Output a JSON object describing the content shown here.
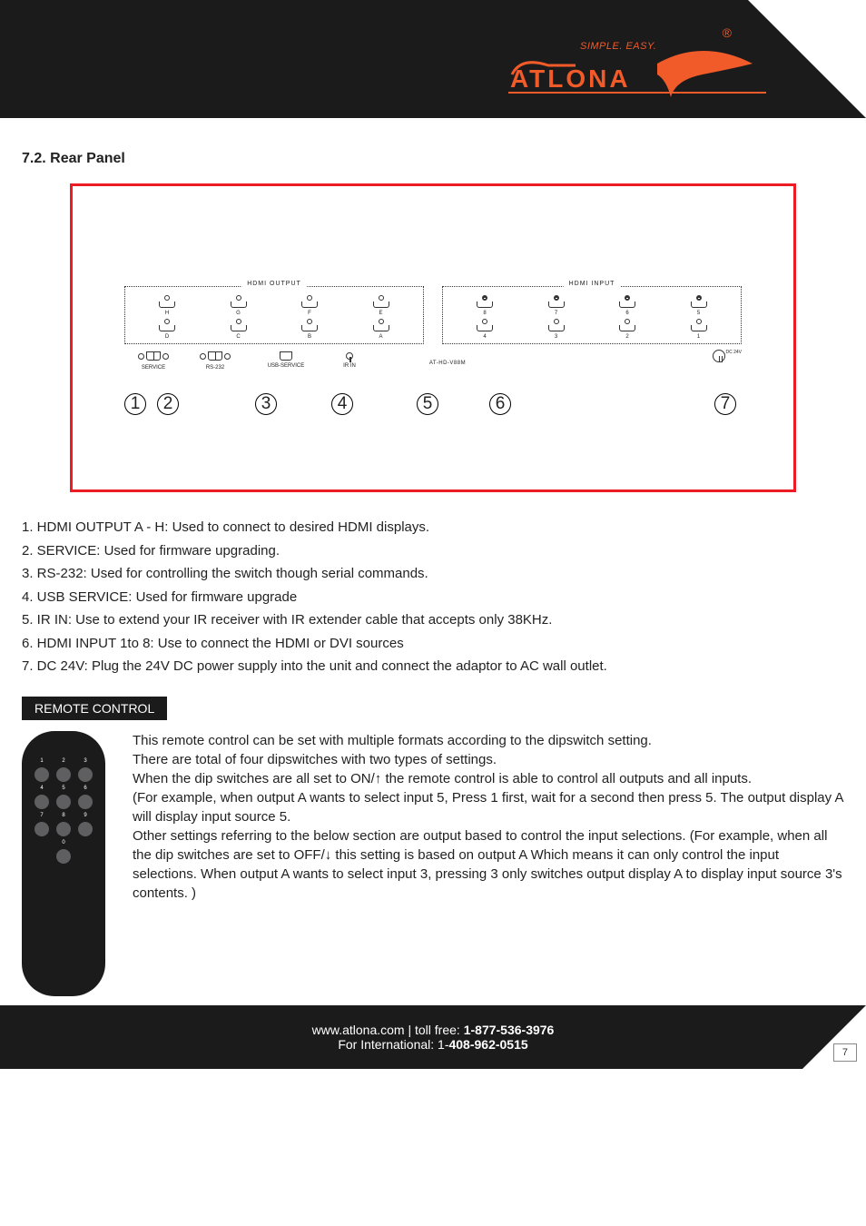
{
  "brand": {
    "tagline": "SIMPLE. EASY.",
    "name": "ATLONA",
    "reg": "®"
  },
  "section_title": "7.2. Rear Panel",
  "panel": {
    "output_label": "HDMI OUTPUT",
    "input_label": "HDMI INPUT",
    "outputs_top": [
      "H",
      "G",
      "F",
      "E"
    ],
    "outputs_bot": [
      "D",
      "C",
      "B",
      "A"
    ],
    "inputs_top": [
      "8",
      "7",
      "6",
      "5"
    ],
    "inputs_bot": [
      "4",
      "3",
      "2",
      "1"
    ],
    "under": {
      "service": "SERVICE",
      "rs232": "RS-232",
      "usb": "USB-SERVICE",
      "ir": "IR IN",
      "model": "AT-HD-V88M",
      "dc": "DC 24V"
    },
    "callouts": [
      "1",
      "2",
      "3",
      "4",
      "5",
      "6",
      "7"
    ]
  },
  "descriptions": [
    "1. HDMI OUTPUT A - H: Used to connect to desired HDMI displays.",
    "2. SERVICE: Used for firmware upgrading.",
    "3. RS-232: Used for controlling the switch though serial commands.",
    "4. USB SERVICE: Used for firmware upgrade",
    "5. IR IN: Use to extend your IR receiver with IR extender cable that accepts   only 38KHz.",
    "6. HDMI INPUT 1to 8: Use to connect the HDMI or DVI sources",
    "7. DC 24V: Plug the 24V DC power supply into the unit and connect the adaptor to AC wall outlet."
  ],
  "remote": {
    "tag": "REMOTE CONTROL",
    "labels": [
      "1",
      "2",
      "3",
      "4",
      "5",
      "6",
      "7",
      "8",
      "9",
      "0"
    ],
    "text": "This remote control can be set with multiple formats  according to the dipswitch setting.\n There are total of four dipswitches with two types of settings.\nWhen the dip switches are all set to ON/↑ the remote control is able to control all outputs and all inputs.\n(For example, when output A wants to select input 5, Press 1 first, wait for a second then press 5. The output display A will display input source 5.\nOther settings referring to the below section are output based to control the input selections. (For example, when all the dip switches are set to OFF/↓ this setting is based on output A Which means it can only control the input selections.  When output A wants to select input 3, pressing  3 only switches output display A to display input source 3's contents. )"
  },
  "footer": {
    "line1_pre": "www.atlona.com | toll free: ",
    "line1_bold": "1-877-536-3976",
    "line2_pre": "For International: 1-",
    "line2_bold": "408-962-0515",
    "page": "7"
  }
}
